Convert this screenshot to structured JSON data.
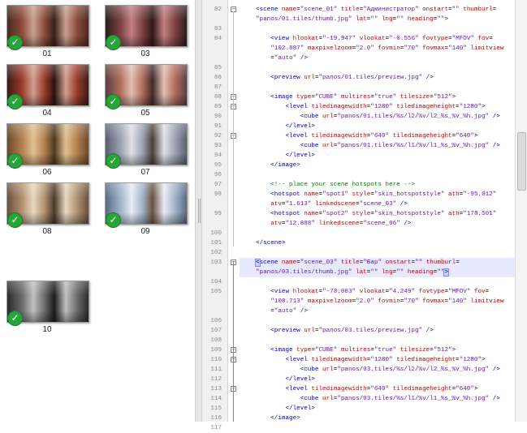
{
  "thumbnails": [
    {
      "label": "01",
      "colors": [
        "#4a2a22",
        "#8c4a3a",
        "#c9a090",
        "#3a2018"
      ]
    },
    {
      "label": "03",
      "colors": [
        "#2a1e1e",
        "#7a4040",
        "#c08080",
        "#301818"
      ]
    },
    {
      "label": "04",
      "colors": [
        "#3a1c18",
        "#9a3a2a",
        "#d0a090",
        "#2a1410"
      ]
    },
    {
      "label": "05",
      "colors": [
        "#5a4040",
        "#b06a5a",
        "#e0c0b0",
        "#402a2a"
      ]
    },
    {
      "label": "06",
      "colors": [
        "#6a4a2a",
        "#b08050",
        "#e0c090",
        "#503820"
      ]
    },
    {
      "label": "07",
      "colors": [
        "#5a6070",
        "#9aa0b0",
        "#e0e0e8",
        "#4a4038"
      ]
    },
    {
      "label": "08",
      "colors": [
        "#6a5040",
        "#b09070",
        "#e8d8c0",
        "#4a3828"
      ]
    },
    {
      "label": "09",
      "colors": [
        "#5a6a80",
        "#a0b0c8",
        "#e8ecf4",
        "#6a5040"
      ]
    },
    {
      "label": "10",
      "colors": [
        "#2a2a2a",
        "#6a6a6a",
        "#c0c0c0",
        "#1a1a1a"
      ]
    }
  ],
  "check_glyph": "✓",
  "code_lines": [
    {
      "n": "82",
      "html": "<span class='t'>&lt;scene</span> <span class='a'>name</span>=<span class='v'>\"scene_01\"</span> <span class='a'>title</span>=<span class='v'>\"Администратор\"</span> <span class='a'>onstart</span>=<span class='v'>\"\"</span> <span class='a'>thumburl</span>="
    },
    {
      "n": "",
      "html": "<span class='v'>\"panos/01.tiles/thumb.jpg\"</span> <span class='a'>lat</span>=<span class='v'>\"\"</span> <span class='a'>lng</span>=<span class='v'>\"\"</span> <span class='a'>heading</span>=<span class='v'>\"\"</span><span class='t'>&gt;</span>"
    },
    {
      "n": "83",
      "html": ""
    },
    {
      "n": "84",
      "html": "    <span class='t'>&lt;view</span> <span class='a'>hlookat</span>=<span class='v'>\"-19.947\"</span> <span class='a'>vlookat</span>=<span class='v'>\"-0.556\"</span> <span class='a'>fovtype</span>=<span class='v'>\"MFOV\"</span> <span class='a'>fov</span>="
    },
    {
      "n": "",
      "html": "    <span class='v'>\"102.887\"</span> <span class='a'>maxpixelzoom</span>=<span class='v'>\"2.0\"</span> <span class='a'>fovmin</span>=<span class='v'>\"70\"</span> <span class='a'>fovmax</span>=<span class='v'>\"140\"</span> <span class='a'>limitview</span>"
    },
    {
      "n": "",
      "html": "    =<span class='v'>\"auto\"</span> <span class='t'>/&gt;</span>"
    },
    {
      "n": "85",
      "html": ""
    },
    {
      "n": "86",
      "html": "    <span class='t'>&lt;preview</span> <span class='a'>url</span>=<span class='v'>\"panos/01.tiles/preview.jpg\"</span> <span class='t'>/&gt;</span>"
    },
    {
      "n": "87",
      "html": ""
    },
    {
      "n": "88",
      "html": "    <span class='t'>&lt;image</span> <span class='a'>type</span>=<span class='v'>\"CUBE\"</span> <span class='a'>multires</span>=<span class='v'>\"true\"</span> <span class='a'>tilesize</span>=<span class='v'>\"512\"</span><span class='t'>&gt;</span>"
    },
    {
      "n": "89",
      "html": "        <span class='t'>&lt;level</span> <span class='a'>tiledimagewidth</span>=<span class='v'>\"1280\"</span> <span class='a'>tiledimageheight</span>=<span class='v'>\"1280\"</span><span class='t'>&gt;</span>"
    },
    {
      "n": "90",
      "html": "            <span class='t'>&lt;cube</span> <span class='a'>url</span>=<span class='v'>\"panos/01.tiles/%s/l2/%v/l2_%s_%v_%h.jpg\"</span> <span class='t'>/&gt;</span>"
    },
    {
      "n": "91",
      "html": "        <span class='t'>&lt;/level&gt;</span>"
    },
    {
      "n": "92",
      "html": "        <span class='t'>&lt;level</span> <span class='a'>tiledimagewidth</span>=<span class='v'>\"640\"</span> <span class='a'>tiledimageheight</span>=<span class='v'>\"640\"</span><span class='t'>&gt;</span>"
    },
    {
      "n": "93",
      "html": "            <span class='t'>&lt;cube</span> <span class='a'>url</span>=<span class='v'>\"panos/01.tiles/%s/l1/%v/l1_%s_%v_%h.jpg\"</span> <span class='t'>/&gt;</span>"
    },
    {
      "n": "94",
      "html": "        <span class='t'>&lt;/level&gt;</span>"
    },
    {
      "n": "95",
      "html": "    <span class='t'>&lt;/image&gt;</span>"
    },
    {
      "n": "96",
      "html": ""
    },
    {
      "n": "97",
      "html": "    <span class='c'>&lt;!-- place your scene hotspots here --&gt;</span>"
    },
    {
      "n": "98",
      "html": "    <span class='t'>&lt;hotspot</span> <span class='a'>name</span>=<span class='v'>\"spot1\"</span> <span class='a'>style</span>=<span class='v'>\"skin_hotspotstyle\"</span> <span class='a'>ath</span>=<span class='v'>\"-95.012\"</span>"
    },
    {
      "n": "",
      "html": "    <span class='a'>atv</span>=<span class='v'>\"1.613\"</span> <span class='a'>linkedscene</span>=<span class='v'>\"scene_03\"</span> <span class='t'>/&gt;</span>"
    },
    {
      "n": "99",
      "html": "    <span class='t'>&lt;hotspot</span> <span class='a'>name</span>=<span class='v'>\"spot2\"</span> <span class='a'>style</span>=<span class='v'>\"skin_hotspotstyle\"</span> <span class='a'>ath</span>=<span class='v'>\"178.501\"</span>"
    },
    {
      "n": "",
      "html": "    <span class='a'>atv</span>=<span class='v'>\"12.888\"</span> <span class='a'>linkedscene</span>=<span class='v'>\"scene_06\"</span> <span class='t'>/&gt;</span>"
    },
    {
      "n": "100",
      "html": ""
    },
    {
      "n": "101",
      "html": "<span class='t'>&lt;/scene&gt;</span>"
    },
    {
      "n": "102",
      "html": ""
    },
    {
      "n": "103",
      "hl": true,
      "html": "<span class='caret'>&lt;</span><span class='t'>scene</span> <span class='a'>name</span>=<span class='v'>\"scene_03\"</span> <span class='a'>title</span>=<span class='v'>\"Бар\"</span> <span class='a'>onstart</span>=<span class='v'>\"\"</span> <span class='a'>thumburl</span>="
    },
    {
      "n": "",
      "hl": true,
      "html": "<span class='v'>\"panos/03.tiles/thumb.jpg\"</span> <span class='a'>lat</span>=<span class='v'>\"\"</span> <span class='a'>lng</span>=<span class='v'>\"\"</span> <span class='a'>heading</span>=<span class='v'>\"\"</span><span class='caret'>&gt;</span>"
    },
    {
      "n": "104",
      "html": ""
    },
    {
      "n": "105",
      "html": "    <span class='t'>&lt;view</span> <span class='a'>hlookat</span>=<span class='v'>\"-78.083\"</span> <span class='a'>vlookat</span>=<span class='v'>\"4.249\"</span> <span class='a'>fovtype</span>=<span class='v'>\"MFOV\"</span> <span class='a'>fov</span>="
    },
    {
      "n": "",
      "html": "    <span class='v'>\"108.713\"</span> <span class='a'>maxpixelzoom</span>=<span class='v'>\"2.0\"</span> <span class='a'>fovmin</span>=<span class='v'>\"70\"</span> <span class='a'>fovmax</span>=<span class='v'>\"140\"</span> <span class='a'>limitview</span>"
    },
    {
      "n": "",
      "html": "    =<span class='v'>\"auto\"</span> <span class='t'>/&gt;</span>"
    },
    {
      "n": "106",
      "html": ""
    },
    {
      "n": "107",
      "html": "    <span class='t'>&lt;preview</span> <span class='a'>url</span>=<span class='v'>\"panos/03.tiles/preview.jpg\"</span> <span class='t'>/&gt;</span>"
    },
    {
      "n": "108",
      "html": ""
    },
    {
      "n": "109",
      "html": "    <span class='t'>&lt;image</span> <span class='a'>type</span>=<span class='v'>\"CUBE\"</span> <span class='a'>multires</span>=<span class='v'>\"true\"</span> <span class='a'>tilesize</span>=<span class='v'>\"512\"</span><span class='t'>&gt;</span>"
    },
    {
      "n": "110",
      "html": "        <span class='t'>&lt;level</span> <span class='a'>tiledimagewidth</span>=<span class='v'>\"1280\"</span> <span class='a'>tiledimageheight</span>=<span class='v'>\"1280\"</span><span class='t'>&gt;</span>"
    },
    {
      "n": "111",
      "html": "            <span class='t'>&lt;cube</span> <span class='a'>url</span>=<span class='v'>\"panos/03.tiles/%s/l2/%v/l2_%s_%v_%h.jpg\"</span> <span class='t'>/&gt;</span>"
    },
    {
      "n": "112",
      "html": "        <span class='t'>&lt;/level&gt;</span>"
    },
    {
      "n": "113",
      "html": "        <span class='t'>&lt;level</span> <span class='a'>tiledimagewidth</span>=<span class='v'>\"640\"</span> <span class='a'>tiledimageheight</span>=<span class='v'>\"640\"</span><span class='t'>&gt;</span>"
    },
    {
      "n": "114",
      "html": "            <span class='t'>&lt;cube</span> <span class='a'>url</span>=<span class='v'>\"panos/03.tiles/%s/l1/%v/l1_%s_%v_%h.jpg\"</span> <span class='t'>/&gt;</span>"
    },
    {
      "n": "115",
      "html": "        <span class='t'>&lt;/level&gt;</span>"
    },
    {
      "n": "116",
      "html": "    <span class='t'>&lt;/image&gt;</span>"
    },
    {
      "n": "117",
      "html": ""
    }
  ]
}
